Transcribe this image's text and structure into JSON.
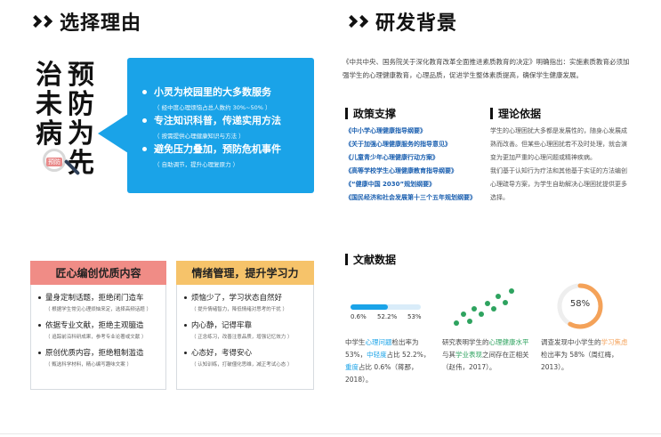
{
  "left": {
    "title": "选择理由",
    "slogan": {
      "col1": [
        "治",
        "未",
        "病"
      ],
      "col2": [
        "预",
        "防",
        "为",
        "先"
      ]
    },
    "magnifier_tag": "预防",
    "reasons": [
      {
        "main": "小灵为校园里的大多数服务",
        "sub": "（ 经中度心理烦恼占总人数约 30%~50% ）"
      },
      {
        "main": "专注知识科普，传递实用方法",
        "sub": "（ 按需提供心理健康知识与方法 ）"
      },
      {
        "main": "避免压力叠加，预防危机事件",
        "sub": "（ 自助调节，提升心理复原力 ）"
      }
    ],
    "card1": {
      "title": "匠心编创优质内容",
      "color": "#f08c86",
      "items": [
        {
          "main": "量身定制话题，拒绝闭门造车",
          "sub": "（ 根据学生常见心理烦恼来定，选择高频话题 ）"
        },
        {
          "main": "依据专业文献，拒绝主观臆造",
          "sub": "（ 追踪前沿科研成果，参考专业论著或文献 ）"
        },
        {
          "main": "原创优质内容，拒绝粗制滥造",
          "sub": "（ 甄选科学材料，精心编写趣味文案 ）"
        }
      ]
    },
    "card2": {
      "title": "情绪管理，提升学习力",
      "color": "#f6c36a",
      "items": [
        {
          "main": "烦恼少了，学习状态自然好",
          "sub": "（ 提升情绪智力，降低情绪对思考的干扰 ）"
        },
        {
          "main": "内心静，记得牢靠",
          "sub": "（ 正念练习，改善注意品质，增强记忆效力 ）"
        },
        {
          "main": "心态好，考得安心",
          "sub": "（ 认知训练，打破僵化思维，减正考试心态 ）"
        }
      ]
    }
  },
  "right": {
    "title": "研发背景",
    "intro": "《中共中央、国务院关于深化教育改革全面推进素质教育的决定》明确指出：实施素质教育必须加强学生的心理健康教育，心理品质，促进学生整体素质提高，确保学生健康发展。",
    "policy_title": "政策支撑",
    "policies": [
      "《中小学心理健康指导纲要》",
      "《关于加强心理健康服务的指导意见》",
      "《儿童青少年心理健康行动方案》",
      "《高等学校学生心理健康教育指导纲要》",
      "《“健康中国 2030”规划纲要》",
      "《国民经济和社会发展第十三个五年规划纲要》"
    ],
    "theory_title": "理论依据",
    "theory": [
      "学生的心理困扰大多都是发展性的，随身心发展成熟而改善。但某些心理困扰若不及时处理，就会演变为更加严重的心理问题或精神疾病。",
      "我们基于认知行为疗法和其他基于实证的方法编创心理疏导方案，为学生自助解决心理困扰提供更多选择。"
    ],
    "literature_title": "文献数据",
    "bar_values": {
      "left": "0.6%",
      "mid": "52.2%",
      "right": "53%",
      "fill": 0.53
    },
    "donut": {
      "label": "58%",
      "value": 0.58,
      "color": "#f4a259",
      "track": "#eeeeee"
    },
    "lit": {
      "col1": {
        "pre": "中学生",
        "hl1": "心理问题",
        "t1": "检出率为 53%，",
        "hl2": "中轻度",
        "t2": "占比 52.2%，",
        "hl3": "重度",
        "t3": "占比 0.6%（蒋那，2018）。"
      },
      "col2": {
        "pre": "研究表明学生的",
        "hl1": "心理健康水平",
        "t1": "与其",
        "hl2": "学业表现",
        "t2": "之间存在正相关（赵伟，2017）。"
      },
      "col3": {
        "pre": "调查发现中小学生的",
        "hl1": "学习焦虑",
        "t1": "检出率为 58%（周红梅，2013）。"
      }
    }
  },
  "colors": {
    "blue": "#1aa3e8",
    "green": "#2ea35f",
    "orange": "#f4a259",
    "pink": "#f08c86",
    "yellow": "#f6c36a"
  }
}
